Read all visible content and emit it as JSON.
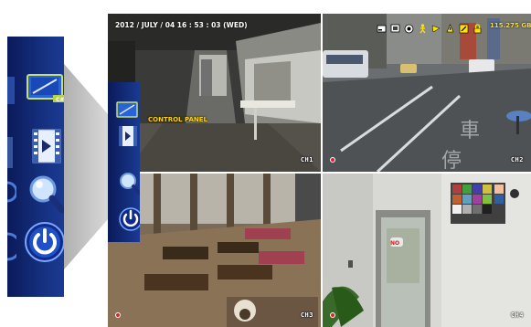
{
  "osd": {
    "datetime": "2012 / JULY / 04   16 : 53 : 03 (WED)",
    "hdd_free": "115.275 GB",
    "status_icons": [
      "hdd-icon",
      "network-icon",
      "record-mode-icon",
      "motion-icon",
      "timer-record-icon",
      "alarm-icon",
      "overwrite-icon",
      "key-lock-icon"
    ]
  },
  "menu": {
    "control_panel_label": "CONTROL PANEL",
    "items": [
      "control-panel-icon",
      "playback-icon",
      "search-icon",
      "power-icon"
    ]
  },
  "channels": [
    {
      "label": "CH1",
      "recording": false
    },
    {
      "label": "CH2",
      "recording": true
    },
    {
      "label": "CH3",
      "recording": true
    },
    {
      "label": "CH4",
      "recording": true
    }
  ],
  "colors": {
    "menu_bg": "#15307f",
    "osd_yellow": "#ffe400",
    "rec_red": "#e0202a"
  }
}
